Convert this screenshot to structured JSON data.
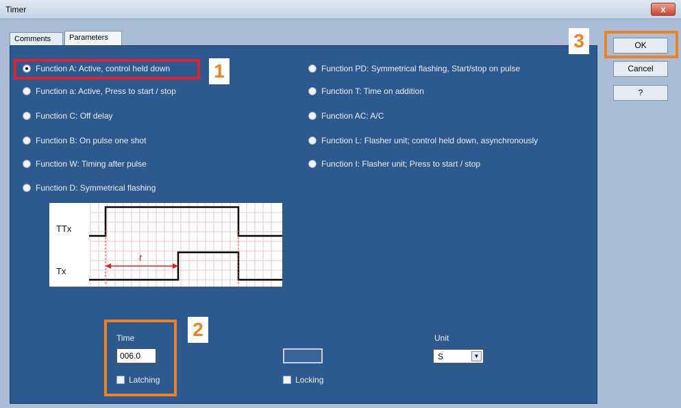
{
  "window": {
    "title": "Timer",
    "close_label": "x"
  },
  "tabs": [
    {
      "label": "Comments"
    },
    {
      "label": "Parameters"
    }
  ],
  "functions_left": [
    {
      "label": "Function A: Active, control held down",
      "selected": true
    },
    {
      "label": "Function a: Active, Press to start / stop",
      "selected": false
    },
    {
      "label": "Function C: Off delay",
      "selected": false
    },
    {
      "label": "Function B: On pulse one shot",
      "selected": false
    },
    {
      "label": "Function W: Timing after pulse",
      "selected": false
    },
    {
      "label": "Function D: Symmetrical flashing",
      "selected": false
    }
  ],
  "functions_right": [
    {
      "label": "Function PD: Symmetrical flashing, Start/stop on pulse",
      "selected": false
    },
    {
      "label": "Function T: Time on addition",
      "selected": false
    },
    {
      "label": "Function AC: A/C",
      "selected": false
    },
    {
      "label": "Function L: Flasher unit; control held down, asynchronously",
      "selected": false
    },
    {
      "label": "Function I: Flasher unit; Press to start / stop",
      "selected": false
    }
  ],
  "diagram": {
    "ttx_label": "TTx",
    "tx_label": "Tx",
    "t_label": "t"
  },
  "time": {
    "label": "Time",
    "value": "006.0"
  },
  "latching": {
    "label": "Latching"
  },
  "locking": {
    "label": "Locking"
  },
  "unit": {
    "label": "Unit",
    "selected": "S"
  },
  "buttons": {
    "ok": "OK",
    "cancel": "Cancel",
    "help": "?"
  },
  "steps": {
    "one": "1",
    "two": "2",
    "three": "3"
  },
  "colors": {
    "panel": "#2d5a8e",
    "highlight_red": "#e0202a",
    "highlight_orange": "#f08020"
  }
}
